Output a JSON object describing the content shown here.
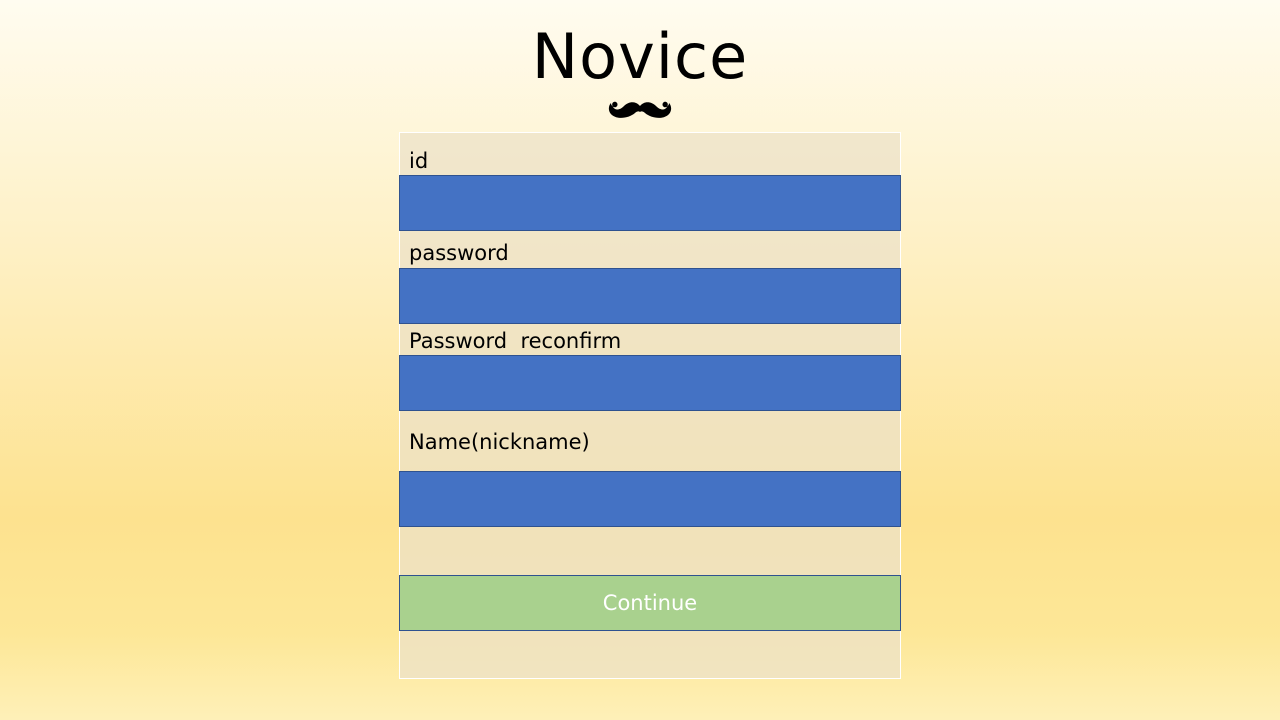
{
  "app": {
    "title": "Novice",
    "logo_icon": "mustache-icon"
  },
  "form": {
    "fields": [
      {
        "label": "id",
        "value": "",
        "type": "text"
      },
      {
        "label": "password",
        "value": "",
        "type": "password"
      },
      {
        "label": "Password  reconfirm",
        "value": "",
        "type": "password"
      },
      {
        "label": "Name(nickname)",
        "value": "",
        "type": "text"
      }
    ],
    "submit_label": "Continue"
  },
  "colors": {
    "input_fill": "#4472c4",
    "input_border": "#2f528f",
    "button_fill": "#a9d18e",
    "button_text": "#ffffff",
    "panel_fill": "#ece2c8"
  }
}
